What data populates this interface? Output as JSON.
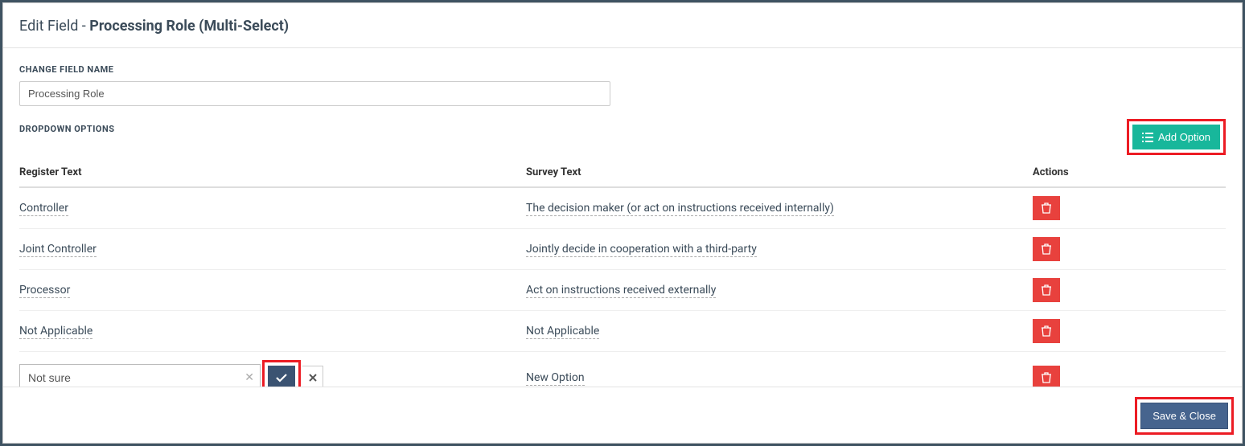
{
  "header": {
    "prefix": "Edit Field - ",
    "title": "Processing Role (Multi-Select)"
  },
  "labels": {
    "change_field_name": "CHANGE FIELD NAME",
    "dropdown_options": "DROPDOWN OPTIONS",
    "add_option": "Add Option",
    "save_close": "Save & Close"
  },
  "field_name_value": "Processing Role",
  "columns": {
    "register": "Register Text",
    "survey": "Survey Text",
    "actions": "Actions"
  },
  "options": [
    {
      "register": "Controller",
      "survey": "The decision maker (or act on instructions received internally)"
    },
    {
      "register": "Joint Controller",
      "survey": "Jointly decide in cooperation with a third-party"
    },
    {
      "register": "Processor",
      "survey": "Act on instructions received externally"
    },
    {
      "register": "Not Applicable",
      "survey": "Not Applicable"
    }
  ],
  "editing_row": {
    "register_value": "Not sure",
    "survey": "New Option"
  }
}
